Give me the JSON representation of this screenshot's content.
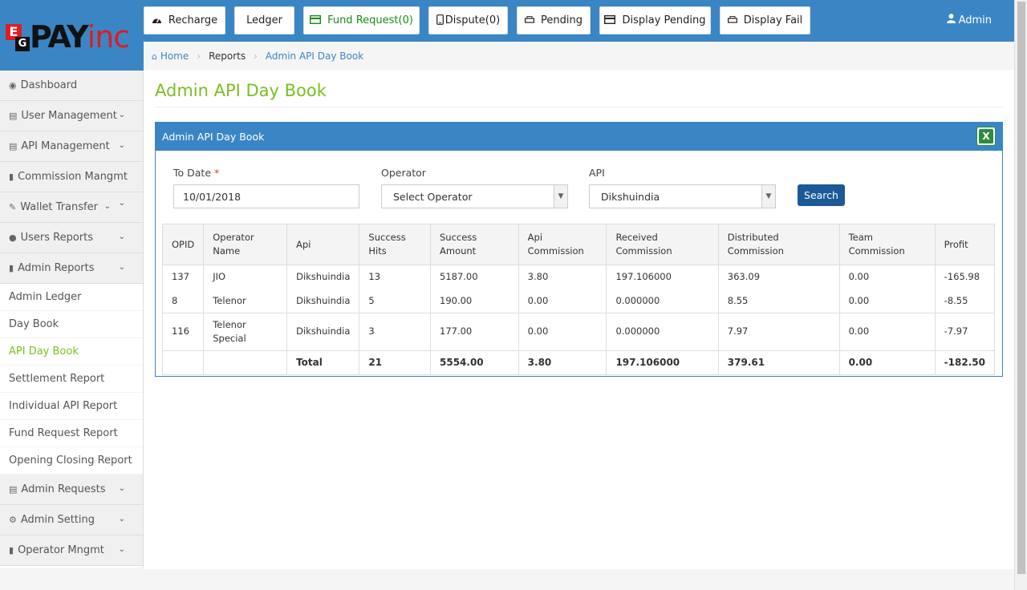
{
  "brand": {
    "e": "E",
    "g": "G",
    "pay": "PAY",
    "inc": "inc"
  },
  "topnav": [
    {
      "label": "Recharge",
      "icon": "dashboard-icon"
    },
    {
      "label": "Ledger",
      "icon": ""
    },
    {
      "label": "Fund Request(0)",
      "icon": "credit-card-icon"
    },
    {
      "label": "Dispute(0)",
      "icon": "phone-icon"
    },
    {
      "label": "Pending",
      "icon": "printer-icon"
    },
    {
      "label": "Display Pending",
      "icon": "credit-card-icon"
    },
    {
      "label": "Display Fail",
      "icon": "printer-icon"
    }
  ],
  "user": {
    "label": "Admin"
  },
  "breadcrumb": {
    "home": "Home",
    "reports": "Reports",
    "current": "Admin API Day Book"
  },
  "sidebar": {
    "dashboard": "Dashboard",
    "user_management": "User Management",
    "api_management": "API Management",
    "commission": "Commission Mangmt",
    "wallet": "Wallet Transfer",
    "users_reports": "Users Reports",
    "admin_reports": "Admin Reports",
    "sub": {
      "admin_ledger": "Admin Ledger",
      "day_book": "Day Book",
      "api_day_book": "API Day Book",
      "settlement": "Settlement Report",
      "individual_api": "Individual API Report",
      "fund_request": "Fund Request Report",
      "opening_closing": "Opening Closing Report"
    },
    "admin_requests": "Admin Requests",
    "admin_setting": "Admin Setting",
    "operator_mngmt": "Operator Mngmt"
  },
  "page": {
    "title": "Admin API Day Book",
    "panel_title": "Admin API Day Book",
    "excel": "X"
  },
  "filters": {
    "to_date_label": "To Date",
    "required_mark": "*",
    "to_date_value": "10/01/2018",
    "operator_label": "Operator",
    "operator_value": "Select Operator",
    "api_label": "API",
    "api_value": "Dikshuindia",
    "search_label": "Search"
  },
  "table": {
    "headers": [
      "OPID",
      "Operator Name",
      "Api",
      "Success Hits",
      "Success Amount",
      "Api Commission",
      "Received Commission",
      "Distributed Commission",
      "Team Commission",
      "Profit"
    ],
    "rows": [
      [
        "137",
        "JIO",
        "Dikshuindia",
        "13",
        "5187.00",
        "3.80",
        "197.106000",
        "363.09",
        "0.00",
        "-165.98"
      ],
      [
        "8",
        "Telenor",
        "Dikshuindia",
        "5",
        "190.00",
        "0.00",
        "0.000000",
        "8.55",
        "0.00",
        "-8.55"
      ],
      [
        "116",
        "Telenor Special",
        "Dikshuindia",
        "3",
        "177.00",
        "0.00",
        "0.000000",
        "7.97",
        "0.00",
        "-7.97"
      ]
    ],
    "total": [
      "",
      "",
      "Total",
      "21",
      "5554.00",
      "3.80",
      "197.106000",
      "379.61",
      "0.00",
      "-182.50"
    ]
  }
}
